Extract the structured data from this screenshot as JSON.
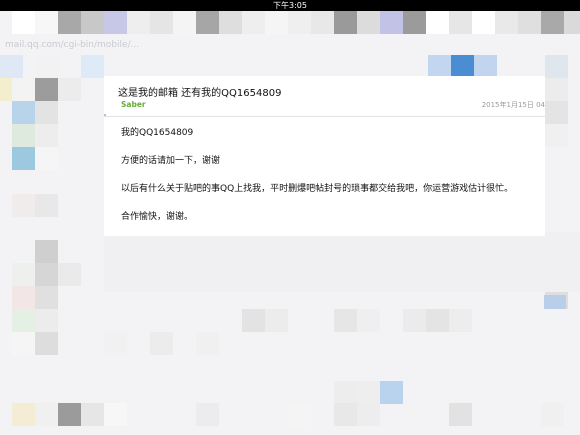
{
  "status_bar": {
    "time": "下午3:05"
  },
  "url_bar": {
    "text": "mail.qq.com/cgi-bin/mobile/..."
  },
  "email": {
    "subject": "这是我的邮箱 还有我的QQ1654809",
    "sender": "Saber",
    "date": "2015年1月15日 04",
    "body": [
      "我的QQ1654809",
      "方便的话请加一下，谢谢",
      "以后有什么关于贴吧的事QQ上找我，平时删爆吧帖封号的琐事都交给我吧，你运营游戏估计很忙。",
      "合作愉快，谢谢。"
    ]
  },
  "colors": {
    "sender": "#6aac3a",
    "date": "#9a9a9a",
    "statusbar": "#000000",
    "background": "#f3f3f5"
  }
}
